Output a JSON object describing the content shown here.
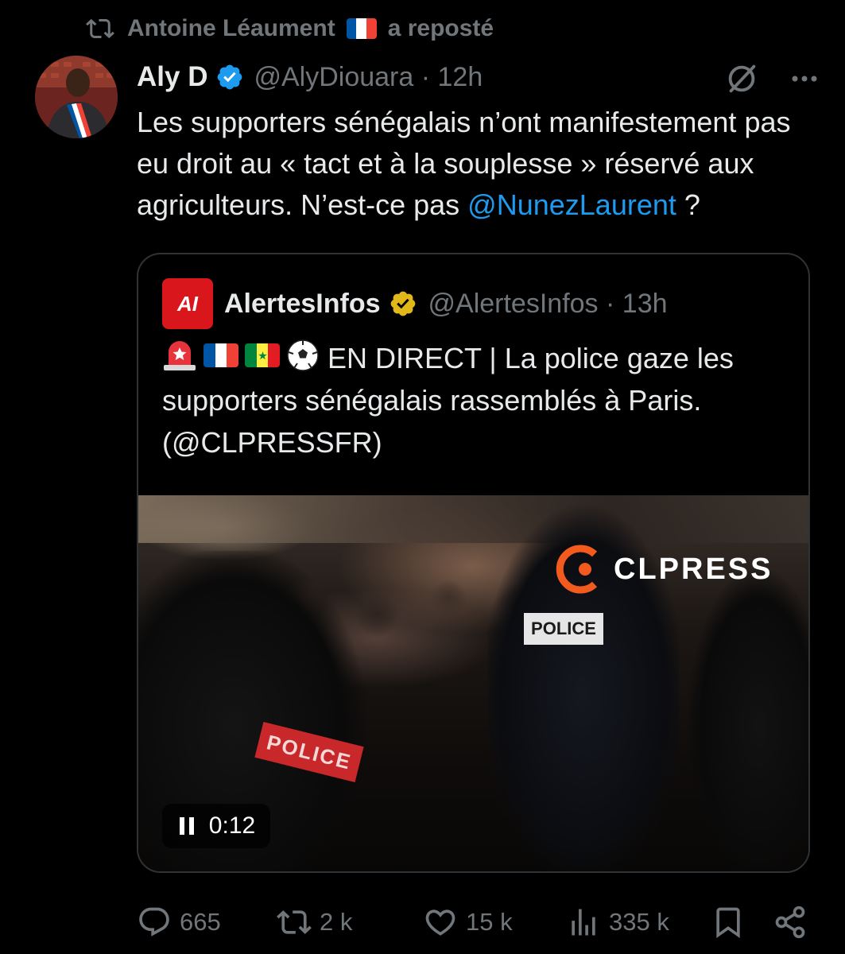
{
  "repost": {
    "user": "Antoine Léaument",
    "suffix": "a reposté",
    "icon": "repost-icon"
  },
  "tweet": {
    "name": "Aly D",
    "handle": "@AlyDiouara",
    "separator": "·",
    "time": "12h",
    "text_before_mention": "Les supporters sénégalais n’ont manifestement pas eu droit au « tact et à la souplesse » réservé aux agriculteurs. N’est-ce pas ",
    "mention": "@NunezLaurent",
    "text_after_mention": " ?"
  },
  "quote": {
    "logo_text": "AI",
    "name": "AlertesInfos",
    "handle": "@AlertesInfos",
    "separator": "·",
    "time": "13h",
    "emojis": [
      "siren-icon",
      "flag-france",
      "flag-senegal",
      "soccer-ball-icon"
    ],
    "text_line1": "EN DIRECT | La police gaze les",
    "text_line2": "supporters sénégalais rassemblés à Paris.",
    "text_line3": "(@CLPRESSFR)",
    "video": {
      "watermark": "CLPRESS",
      "badge1": "POLICE",
      "badge2": "POLICE",
      "time": "0:12"
    }
  },
  "actions": {
    "replies": "665",
    "reposts": "2 k",
    "likes": "15 k",
    "views": "335 k"
  },
  "colors": {
    "background": "#000000",
    "text": "#e7e9ea",
    "muted": "#71767b",
    "link": "#1d9bf0",
    "verified_blue": "#1d9bf0",
    "verified_gold": "#e2b719",
    "border": "#2f3336"
  }
}
